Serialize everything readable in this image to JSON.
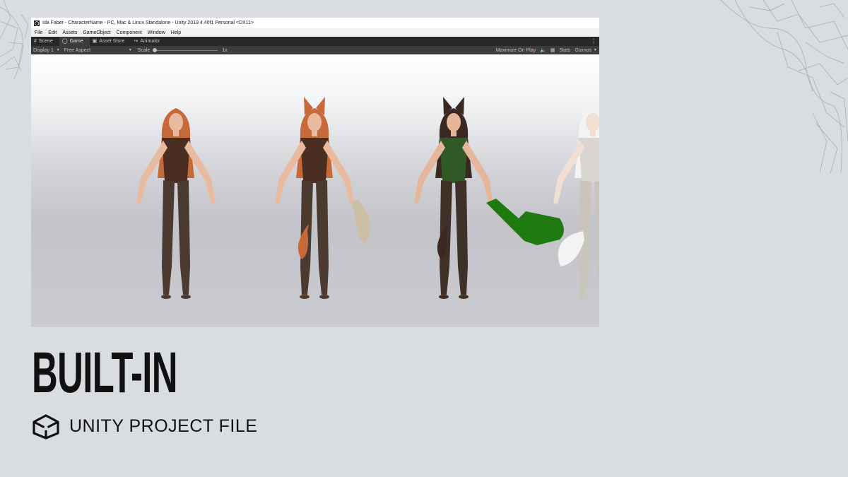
{
  "window": {
    "title": "Ida Faber - CharacterName - PC, Mac & Linux Standalone - Unity 2019.4.40f1 Personal <DX11>",
    "menu": [
      "File",
      "Edit",
      "Assets",
      "GameObject",
      "Component",
      "Window",
      "Help"
    ],
    "tabs": [
      {
        "label": "Scene",
        "icon": "grid-icon"
      },
      {
        "label": "Game",
        "icon": "gamepad-icon"
      },
      {
        "label": "Asset Store",
        "icon": "store-icon"
      },
      {
        "label": "Animator",
        "icon": "animator-icon"
      }
    ],
    "toolbar": {
      "display": "Display 1",
      "aspect": "Free Aspect",
      "scale_label": "Scale",
      "scale_value": "1x",
      "maximize": "Maximize On Play",
      "stats": "Stats",
      "gizmos": "Gizmos"
    }
  },
  "viewport": {
    "characters": [
      {
        "skin": "#e8bba0",
        "hair": "#c66a3a",
        "outfit": "#4a2e22",
        "boots": "#4b3a2f",
        "ears": false,
        "weapon": false
      },
      {
        "skin": "#e8bba0",
        "hair": "#c66a3a",
        "outfit": "#4a2e22",
        "boots": "#4b3a2f",
        "ears": true,
        "weapon": true,
        "weapon_color": "#cdbfa6"
      },
      {
        "skin": "#e6b69a",
        "hair": "#3a2922",
        "outfit": "#2f5a25",
        "boots": "#3f3028",
        "ears": true,
        "weapon": true,
        "weapon_color": "#1f7a12"
      },
      {
        "skin": "#f1dfd4",
        "hair": "#f3f3f3",
        "outfit": "#d9d6d1",
        "boots": "#c9c4bc",
        "ears": true,
        "weapon": false
      }
    ]
  },
  "heading": "BUILT-IN",
  "subtitle": "UNITY PROJECT FILE",
  "colors": {
    "background": "#d9dce1",
    "text": "#111111",
    "unity_dark": "#282828"
  }
}
